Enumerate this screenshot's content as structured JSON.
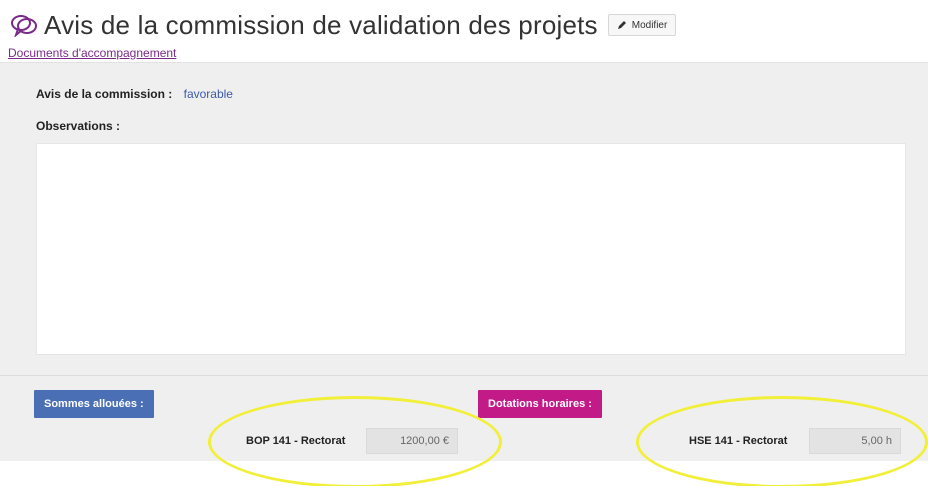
{
  "header": {
    "title": "Avis de la commission de validation des projets",
    "edit_label": "Modifier",
    "docs_link": "Documents d'accompagnement"
  },
  "commission": {
    "avis_label": "Avis de la commission :",
    "avis_value": "favorable",
    "observations_label": "Observations :",
    "observations_value": ""
  },
  "allocations": {
    "sommes_label": "Sommes allouées :",
    "dotations_label": "Dotations horaires :",
    "bop_label": "BOP 141 - Rectorat",
    "bop_value": "1200,00 €",
    "hse_label": "HSE 141 - Rectorat",
    "hse_value": "5,00 h"
  },
  "icons": {
    "title_icon": "speech-bubbles-icon",
    "edit_icon": "pencil-icon"
  },
  "colors": {
    "sommes_badge": "#4b6fb5",
    "dotations_badge": "#c21a87",
    "link": "#7a2b8a",
    "avis_value": "#3d5aa8",
    "highlight": "#f2ef3a"
  }
}
